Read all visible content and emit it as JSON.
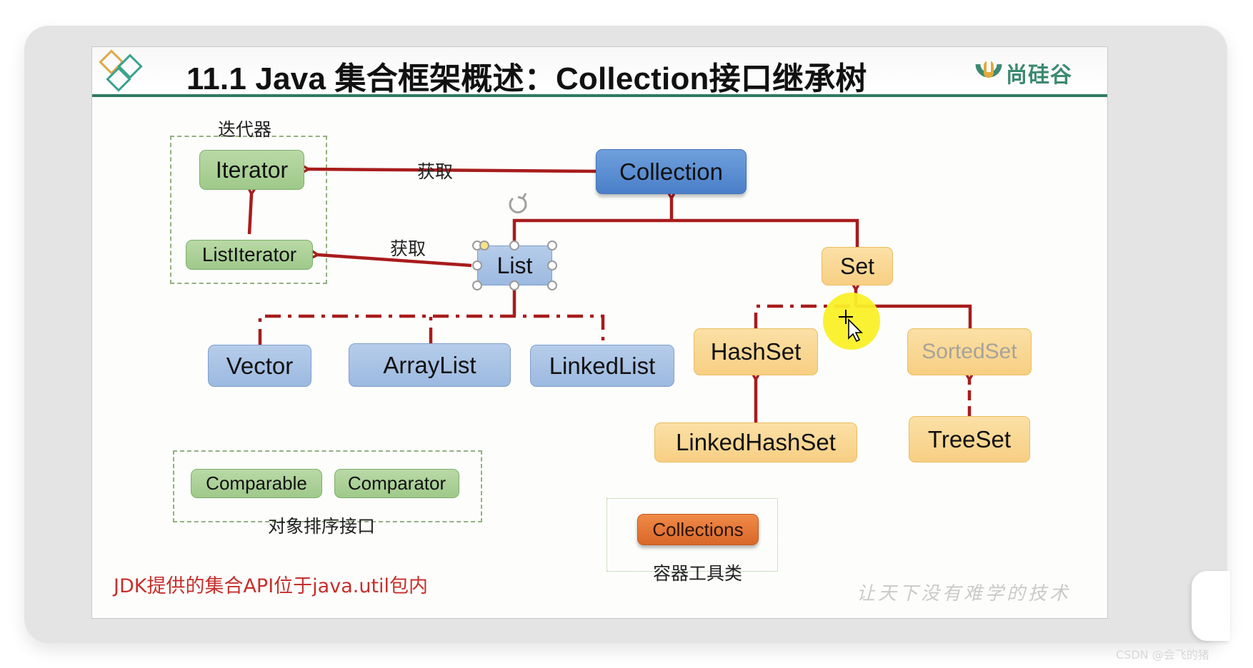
{
  "slide": {
    "title": "11.1 Java 集合框架概述：Collection接口继承树",
    "brand": "尚硅谷",
    "footer_note": "JDK提供的集合API位于java.util包内",
    "slogan": "让天下没有难学的技术"
  },
  "groups": {
    "iterator_group_label": "迭代器",
    "sort_group_label": "对象排序接口",
    "tools_group_label": "容器工具类"
  },
  "edge_labels": {
    "get_iterator": "获取",
    "get_list_iterator": "获取"
  },
  "nodes": {
    "iterator": "Iterator",
    "list_iterator": "ListIterator",
    "collection": "Collection",
    "list": "List",
    "set": "Set",
    "vector": "Vector",
    "array_list": "ArrayList",
    "linked_list": "LinkedList",
    "hash_set": "HashSet",
    "sorted_set": "SortedSet",
    "linked_hash_set": "LinkedHashSet",
    "tree_set": "TreeSet",
    "comparable": "Comparable",
    "comparator": "Comparator",
    "collections": "Collections"
  },
  "edges": [
    {
      "from": "Collection",
      "to": "Iterator",
      "type": "obtains",
      "label": "获取"
    },
    {
      "from": "ListIterator",
      "to": "Iterator",
      "type": "extends"
    },
    {
      "from": "List",
      "to": "ListIterator",
      "type": "obtains",
      "label": "获取"
    },
    {
      "from": "List",
      "to": "Collection",
      "type": "extends"
    },
    {
      "from": "Set",
      "to": "Collection",
      "type": "extends"
    },
    {
      "from": "Vector",
      "to": "List",
      "type": "implements"
    },
    {
      "from": "ArrayList",
      "to": "List",
      "type": "implements"
    },
    {
      "from": "LinkedList",
      "to": "List",
      "type": "implements"
    },
    {
      "from": "HashSet",
      "to": "Set",
      "type": "implements"
    },
    {
      "from": "SortedSet",
      "to": "Set",
      "type": "extends"
    },
    {
      "from": "LinkedHashSet",
      "to": "HashSet",
      "type": "extends"
    },
    {
      "from": "TreeSet",
      "to": "SortedSet",
      "type": "implements"
    }
  ],
  "colors": {
    "arrow": "#a81c1c",
    "header_rule": "#2f7a63",
    "footer_note": "#c72e2b"
  },
  "watermark": "CSDN @会飞的猪"
}
